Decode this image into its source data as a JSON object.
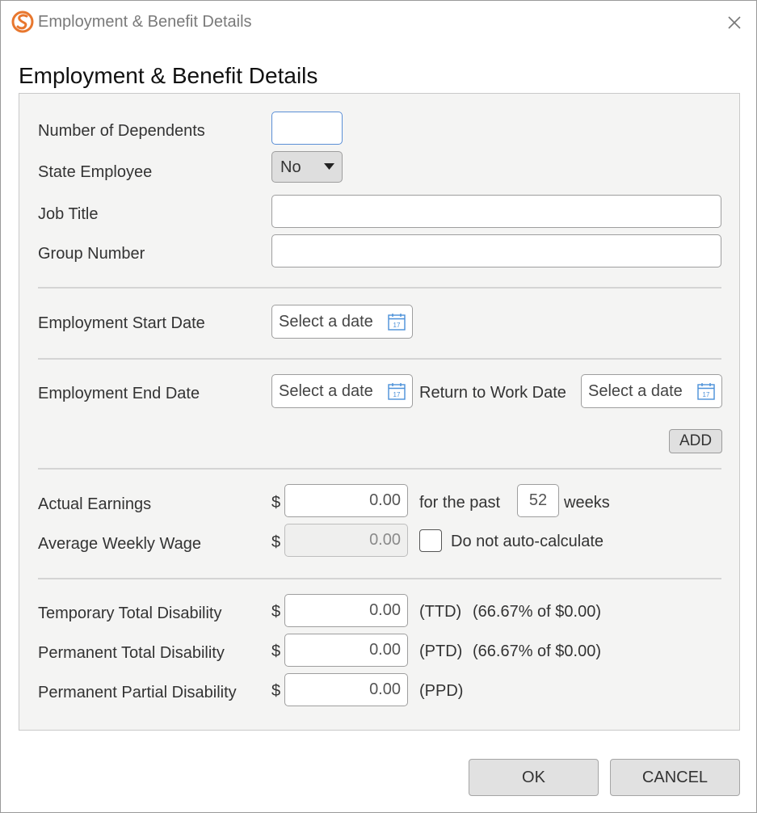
{
  "window": {
    "title": "Employment & Benefit Details",
    "logo_icon": "app-logo-icon",
    "close_icon": "close-icon"
  },
  "heading": "Employment & Benefit Details",
  "fields": {
    "dependents": {
      "label": "Number of Dependents",
      "value": ""
    },
    "state_employee": {
      "label": "State Employee",
      "selected": "No"
    },
    "job_title": {
      "label": "Job Title",
      "value": ""
    },
    "group_number": {
      "label": "Group Number",
      "value": ""
    },
    "start_date": {
      "label": "Employment Start Date",
      "placeholder": "Select a date"
    },
    "end_date": {
      "label": "Employment End Date",
      "placeholder": "Select a date"
    },
    "return_date": {
      "label": "Return to Work Date",
      "placeholder": "Select a date"
    },
    "add_label": "ADD",
    "actual_earnings": {
      "label": "Actual Earnings",
      "currency": "$",
      "value": "0.00",
      "for_past": "for the past",
      "weeks_value": "52",
      "weeks_label": "weeks"
    },
    "avg_weekly_wage": {
      "label": "Average Weekly Wage",
      "currency": "$",
      "value": "0.00",
      "checkbox_label": "Do not auto-calculate",
      "checked": false
    },
    "ttd": {
      "label": "Temporary Total Disability",
      "currency": "$",
      "value": "0.00",
      "code": "(TTD)",
      "note": "(66.67% of $0.00)"
    },
    "ptd": {
      "label": "Permanent Total Disability",
      "currency": "$",
      "value": "0.00",
      "code": "(PTD)",
      "note": "(66.67% of $0.00)"
    },
    "ppd": {
      "label": "Permanent Partial Disability",
      "currency": "$",
      "value": "0.00",
      "code": "(PPD)"
    }
  },
  "buttons": {
    "ok": "OK",
    "cancel": "CANCEL"
  },
  "colors": {
    "logo": "#e8772e",
    "focus": "#5b8fd6",
    "calendar": "#4a90d9"
  }
}
